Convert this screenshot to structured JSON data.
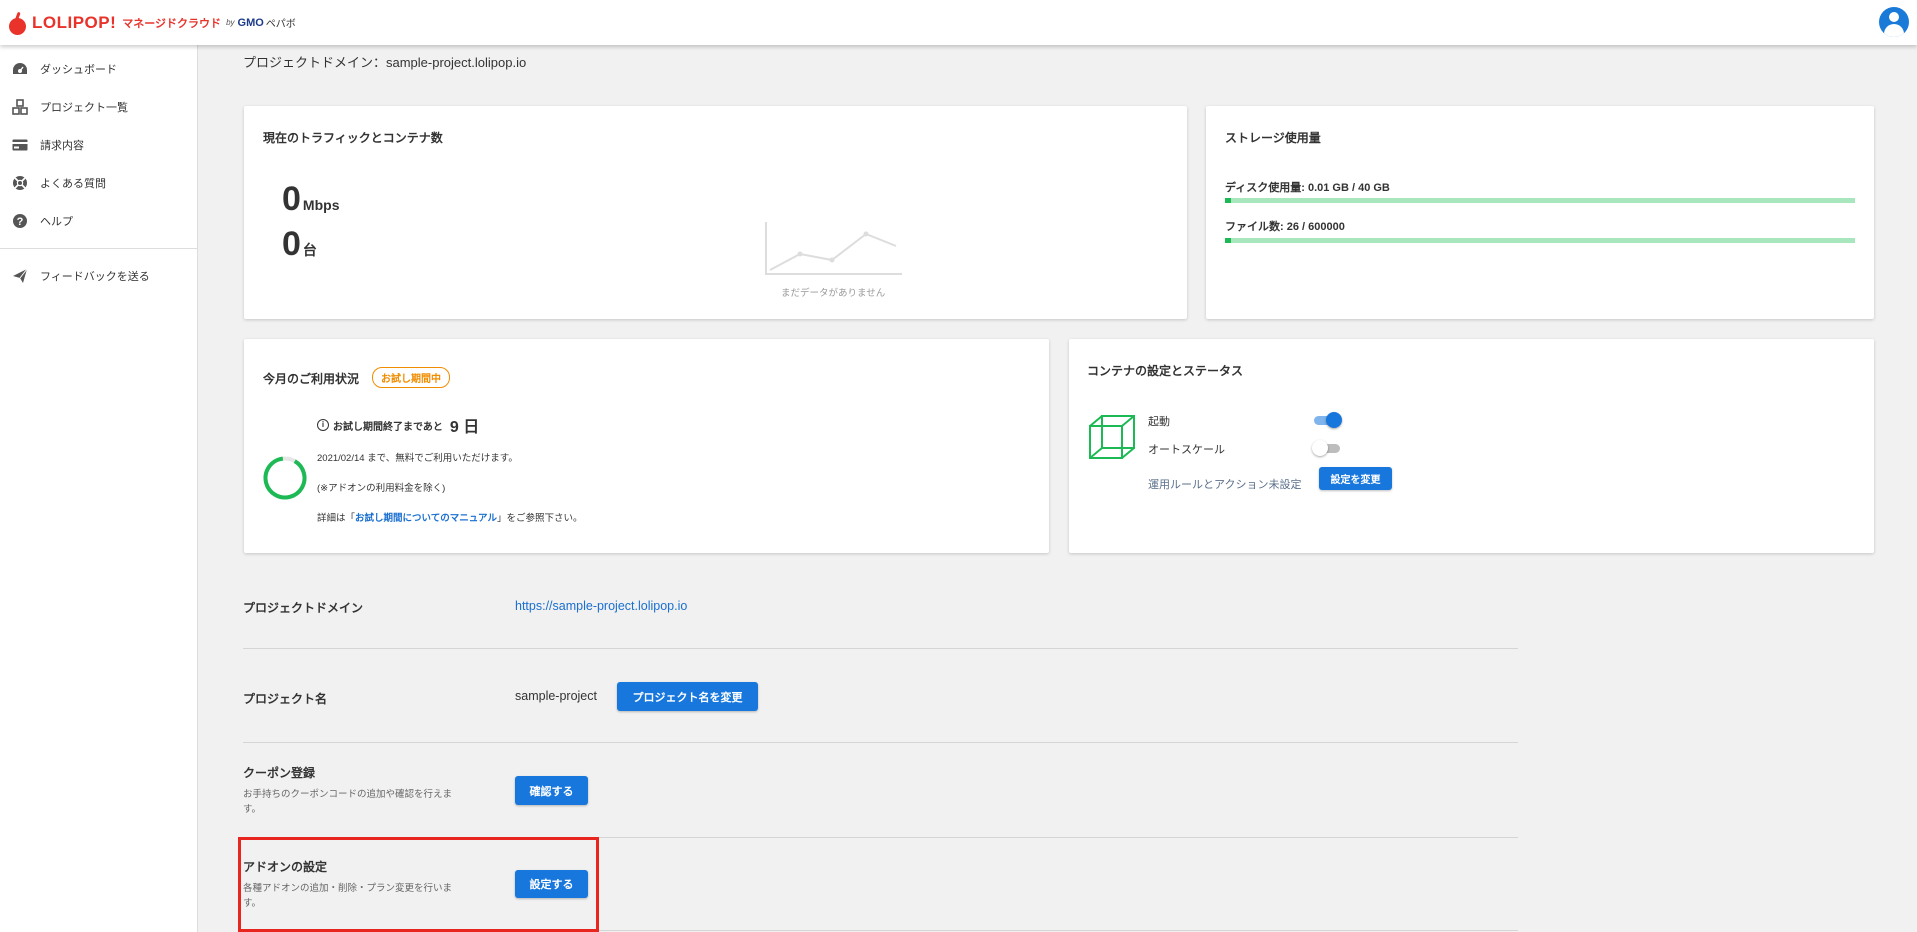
{
  "header": {
    "logo_text": "LOLIPOP!",
    "logo_sub": "マネージドクラウド",
    "logo_by": "by",
    "logo_gmo": "GMO",
    "logo_pepabo": "ペパボ"
  },
  "sidebar": {
    "items": [
      {
        "label": "ダッシュボード",
        "icon": "dashboard-icon"
      },
      {
        "label": "プロジェクト一覧",
        "icon": "projects-icon"
      },
      {
        "label": "請求内容",
        "icon": "credit-card-icon"
      },
      {
        "label": "よくある質問",
        "icon": "lifebuoy-icon"
      },
      {
        "label": "ヘルプ",
        "icon": "help-icon"
      }
    ],
    "feedback_label": "フィードバックを送る"
  },
  "project_domain_heading": "プロジェクトドメイン：sample-project.lolipop.io",
  "traffic": {
    "title": "現在のトラフィックとコンテナ数",
    "mbps_value": "0",
    "mbps_unit": "Mbps",
    "containers_value": "0",
    "containers_unit": "台",
    "no_data": "まだデータがありません"
  },
  "storage": {
    "title": "ストレージ使用量",
    "disk_label": "ディスク使用量: 0.01 GB / 40 GB",
    "disk_fraction": 0.005,
    "files_label": "ファイル数: 26 / 600000",
    "files_fraction": 0.005,
    "accent": "#1db954"
  },
  "usage": {
    "title": "今月のご利用状況",
    "badge": "お試し期間中",
    "trial_prefix": "お試し期間終了まであと",
    "trial_days": "9 日",
    "line1": "2021/02/14 まで、無料でご利用いただけます。",
    "line2": "(※アドオンの利用料金を除く)",
    "line3_prefix": "詳細は「",
    "line3_link": "お試し期間についてのマニュアル",
    "line3_suffix": "」をご参照下さい。"
  },
  "container": {
    "title": "コンテナの設定とステータス",
    "start_label": "起動",
    "start_on": true,
    "autoscale_label": "オートスケール",
    "autoscale_on": false,
    "rule_text": "運用ルールとアクション未設定",
    "change_button": "設定を変更"
  },
  "settings": {
    "domain_label": "プロジェクトドメイン",
    "domain_value": "https://sample-project.lolipop.io",
    "name_label": "プロジェクト名",
    "name_value": "sample-project",
    "name_button": "プロジェクト名を変更",
    "coupon_label": "クーポン登録",
    "coupon_desc": "お手持ちのクーポンコードの追加や確認を行えます。",
    "coupon_button": "確認する",
    "addon_label": "アドオンの設定",
    "addon_desc": "各種アドオンの追加・削除・プラン変更を行います。",
    "addon_button": "設定する"
  }
}
